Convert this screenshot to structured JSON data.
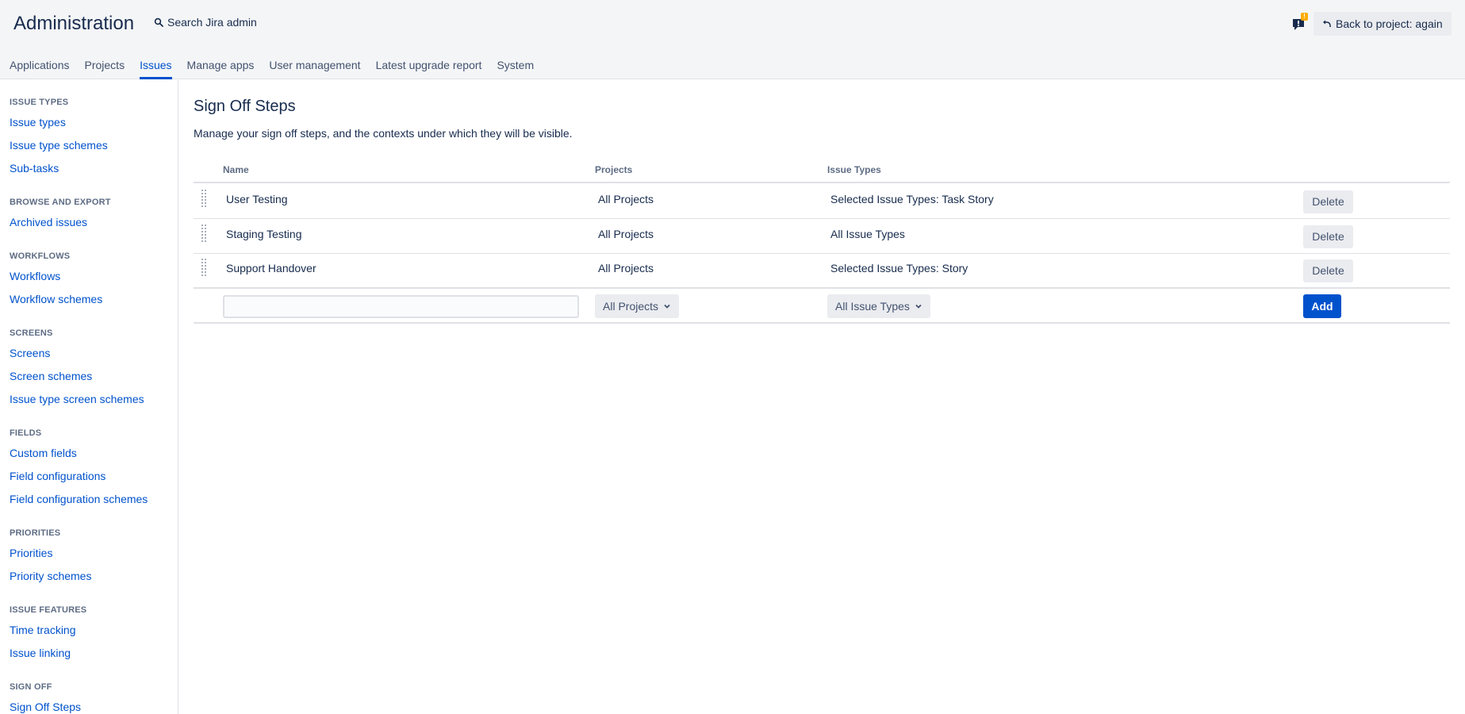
{
  "header": {
    "title": "Administration",
    "search_label": "Search Jira admin",
    "feedback_badge": "!",
    "back_label": "Back to project: again",
    "icons": {
      "search": "search-icon",
      "feedback": "feedback-icon",
      "back": "back-arrow-icon"
    }
  },
  "topnav": {
    "tabs": [
      {
        "label": "Applications",
        "active": false
      },
      {
        "label": "Projects",
        "active": false
      },
      {
        "label": "Issues",
        "active": true
      },
      {
        "label": "Manage apps",
        "active": false
      },
      {
        "label": "User management",
        "active": false
      },
      {
        "label": "Latest upgrade report",
        "active": false
      },
      {
        "label": "System",
        "active": false
      }
    ]
  },
  "sidebar": {
    "sections": [
      {
        "heading": "ISSUE TYPES",
        "items": [
          "Issue types",
          "Issue type schemes",
          "Sub-tasks"
        ]
      },
      {
        "heading": "BROWSE AND EXPORT",
        "items": [
          "Archived issues"
        ]
      },
      {
        "heading": "WORKFLOWS",
        "items": [
          "Workflows",
          "Workflow schemes"
        ]
      },
      {
        "heading": "SCREENS",
        "items": [
          "Screens",
          "Screen schemes",
          "Issue type screen schemes"
        ]
      },
      {
        "heading": "FIELDS",
        "items": [
          "Custom fields",
          "Field configurations",
          "Field configuration schemes"
        ]
      },
      {
        "heading": "PRIORITIES",
        "items": [
          "Priorities",
          "Priority schemes"
        ]
      },
      {
        "heading": "ISSUE FEATURES",
        "items": [
          "Time tracking",
          "Issue linking"
        ]
      },
      {
        "heading": "SIGN OFF",
        "items": [
          "Sign Off Steps"
        ]
      }
    ]
  },
  "main": {
    "title": "Sign Off Steps",
    "description": "Manage your sign off steps, and the contexts under which they will be visible.",
    "columns": {
      "name": "Name",
      "projects": "Projects",
      "issue_types": "Issue Types"
    },
    "rows": [
      {
        "name": "User Testing",
        "projects": "All Projects",
        "issue_types": "Selected Issue Types: Task Story",
        "action": "Delete"
      },
      {
        "name": "Staging Testing",
        "projects": "All Projects",
        "issue_types": "All Issue Types",
        "action": "Delete"
      },
      {
        "name": "Support Handover",
        "projects": "All Projects",
        "issue_types": "Selected Issue Types: Story",
        "action": "Delete"
      }
    ],
    "add_form": {
      "name_value": "",
      "projects_select": "All Projects",
      "issue_types_select": "All Issue Types",
      "add_label": "Add"
    }
  },
  "colors": {
    "accent": "#0052cc",
    "header_bg": "#f4f5f7",
    "heading_gray": "#5e6c84",
    "badge_orange": "#ffab00"
  }
}
